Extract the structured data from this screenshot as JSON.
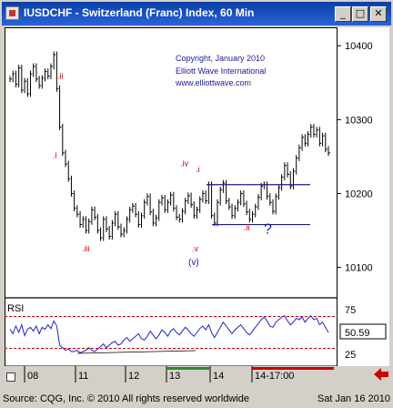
{
  "window": {
    "title": "IUSDCHF - Switzerland (Franc) Index, 60 Min",
    "buttons": {
      "minimize": "_",
      "maximize": "□",
      "close": "✕"
    }
  },
  "copyright": [
    "Copyright, January 2010",
    "Elliott Wave International",
    "www.elliottwave.com"
  ],
  "price_axis": {
    "labels": [
      "10400",
      "10300",
      "10200",
      "10100"
    ]
  },
  "rsi_axis": {
    "labels": [
      "75",
      "25"
    ],
    "current": "50.59"
  },
  "time_axis": {
    "labels": [
      "08",
      "11",
      "12",
      "13",
      "14",
      "14-17:00"
    ]
  },
  "footer": {
    "source": "Source: CQG, Inc. © 2010 All rights reserved worldwide",
    "date": "Sat Jan 16 2010"
  },
  "colors": {
    "title_bg": "#0a3fa8",
    "wave_label": "#cc0000",
    "wave_label_blue": "#1a1aa0",
    "copyright": "#1a1aa0",
    "rsi_line": "#2222cc",
    "rsi_level": "#cc0000"
  },
  "chart_data": [
    {
      "type": "bar",
      "title": "IUSDCHF - Switzerland (Franc) Index, 60 Min",
      "ylim": [
        10065,
        10420
      ],
      "yticks": [
        10400,
        10300,
        10200,
        10100
      ],
      "x_ticks": [
        "08",
        "11",
        "12",
        "13",
        "14",
        "14-17:00"
      ],
      "wave_labels": [
        {
          "text": ".ii",
          "color": "red",
          "price": 10355
        },
        {
          "text": ".i",
          "color": "red",
          "price": 10248
        },
        {
          "text": ".iii",
          "color": "red",
          "price": 10122
        },
        {
          "text": ".iv",
          "color": "red",
          "price": 10237
        },
        {
          "text": ".i",
          "color": "red",
          "price": 10229
        },
        {
          "text": ".v",
          "color": "red",
          "price": 10122
        },
        {
          "text": "(v)",
          "color": "blue",
          "price": 10103
        },
        {
          "text": ".ii",
          "color": "red",
          "price": 10150
        },
        {
          "text": "?",
          "color": "blue",
          "price": 10146
        }
      ],
      "horizontal_lines": [
        10212,
        10158
      ],
      "closes": [
        10355,
        10362,
        10348,
        10370,
        10340,
        10352,
        10335,
        10362,
        10372,
        10355,
        10346,
        10356,
        10365,
        10359,
        10372,
        10388,
        10342,
        10290,
        10255,
        10240,
        10220,
        10200,
        10180,
        10172,
        10158,
        10165,
        10150,
        10162,
        10178,
        10168,
        10150,
        10140,
        10165,
        10152,
        10142,
        10160,
        10172,
        10155,
        10145,
        10150,
        10165,
        10178,
        10183,
        10172,
        10158,
        10170,
        10188,
        10196,
        10175,
        10160,
        10167,
        10188,
        10194,
        10178,
        10188,
        10198,
        10180,
        10168,
        10165,
        10176,
        10190,
        10197,
        10185,
        10170,
        10178,
        10192,
        10200,
        10190,
        10212,
        10170,
        10160,
        10188,
        10205,
        10214,
        10190,
        10182,
        10170,
        10180,
        10188,
        10200,
        10186,
        10175,
        10165,
        10172,
        10182,
        10195,
        10210,
        10212,
        10196,
        10188,
        10176,
        10196,
        10208,
        10222,
        10238,
        10226,
        10210,
        10230,
        10248,
        10262,
        10276,
        10268,
        10280,
        10290,
        10280,
        10286,
        10268,
        10278,
        10260,
        10255
      ],
      "bar_range": 14
    },
    {
      "type": "line",
      "title": "RSI",
      "ylim": [
        0,
        100
      ],
      "levels": [
        75,
        25
      ],
      "last_value": 50.59,
      "values": [
        55,
        48,
        60,
        50,
        62,
        45,
        55,
        58,
        52,
        60,
        48,
        58,
        55,
        62,
        56,
        68,
        60,
        30,
        26,
        22,
        24,
        20,
        20,
        22,
        18,
        20,
        22,
        26,
        22,
        20,
        24,
        28,
        32,
        26,
        30,
        34,
        36,
        30,
        32,
        38,
        42,
        36,
        40,
        44,
        48,
        40,
        38,
        44,
        52,
        46,
        40,
        46,
        54,
        50,
        44,
        52,
        56,
        50,
        46,
        52,
        58,
        54,
        48,
        44,
        50,
        56,
        60,
        54,
        62,
        50,
        42,
        50,
        58,
        66,
        60,
        54,
        48,
        54,
        58,
        62,
        56,
        50,
        46,
        52,
        58,
        64,
        70,
        74,
        68,
        60,
        58,
        66,
        70,
        74,
        76,
        68,
        62,
        66,
        72,
        70,
        74,
        66,
        72,
        76,
        70,
        72,
        62,
        66,
        58,
        50
      ]
    }
  ]
}
